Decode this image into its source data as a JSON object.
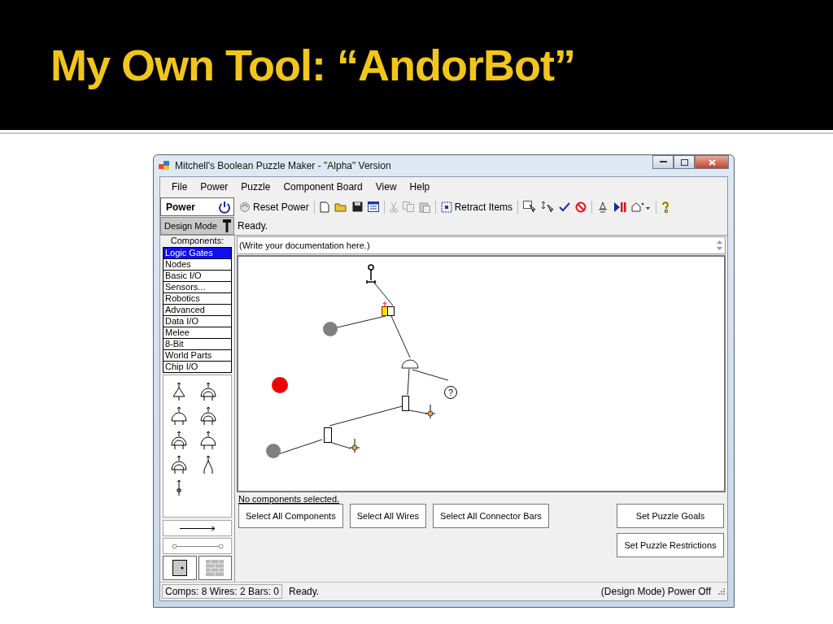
{
  "slide": {
    "title": "My Own Tool: “AndorBot”"
  },
  "window": {
    "title": "Mitchell's Boolean Puzzle Maker - \"Alpha\" Version"
  },
  "menu": [
    {
      "label": "File"
    },
    {
      "label": "Power"
    },
    {
      "label": "Puzzle"
    },
    {
      "label": "Component Board"
    },
    {
      "label": "View"
    },
    {
      "label": "Help"
    }
  ],
  "power_panel": {
    "label": "Power"
  },
  "toolbar": {
    "reset_label": "Reset Power",
    "retract_label": "Retract Items"
  },
  "design_mode": {
    "label": "Design Mode"
  },
  "status_line": "Ready.",
  "components": {
    "header": "Components:",
    "categories": [
      {
        "label": "Logic Gates",
        "selected": true
      },
      {
        "label": "Nodes",
        "selected": false
      },
      {
        "label": "Basic I/O",
        "selected": false
      },
      {
        "label": "Sensors...",
        "selected": false
      },
      {
        "label": "Robotics",
        "selected": false
      },
      {
        "label": "Advanced",
        "selected": false
      },
      {
        "label": "Data I/O",
        "selected": false
      },
      {
        "label": "Melee",
        "selected": false
      },
      {
        "label": "8-Bit",
        "selected": false
      },
      {
        "label": "World Parts",
        "selected": false
      },
      {
        "label": "Chip I/O",
        "selected": false
      }
    ]
  },
  "documentation": {
    "value": "(Write your documentation here.)"
  },
  "canvas": {
    "query_label": "?"
  },
  "selection_info": "No components selected.",
  "select_buttons": [
    "Select All Components",
    "Select All Wires",
    "Select All Connector Bars"
  ],
  "puzzle_buttons": [
    "Set Puzzle Goals",
    "Set Puzzle Restrictions"
  ],
  "status_bar": {
    "counts": "Comps: 8 Wires: 2 Bars: 0",
    "message": "Ready.",
    "mode": "(Design Mode) Power Off"
  }
}
